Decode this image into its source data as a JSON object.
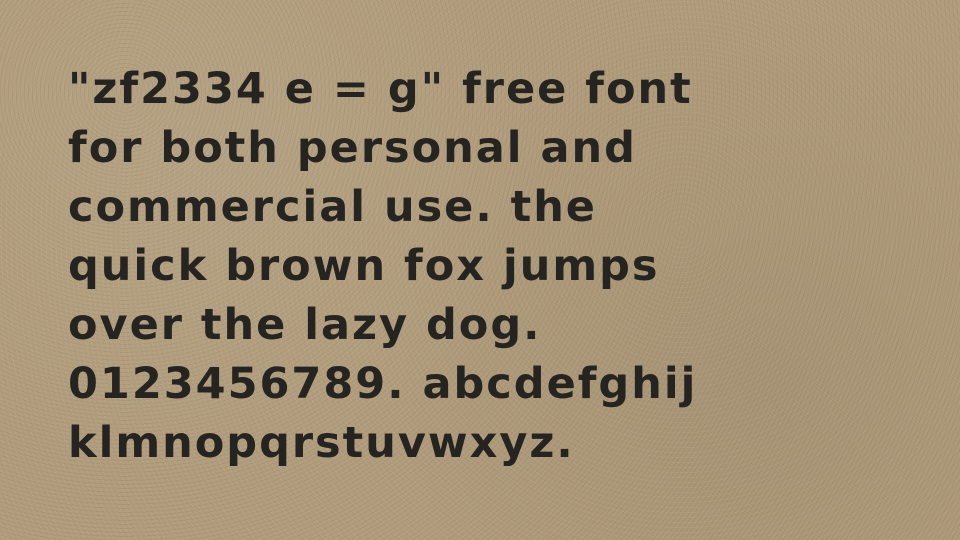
{
  "sample": {
    "lines": [
      "\"ZF2334 E = G\" FREE FONT",
      "FOR BOTH PERSONAL AND",
      "COMMERCIAL USE. THE",
      "QUICK BROWN FOX JUMPS",
      "OVER THE LAZY DOG.",
      "0123456789. ABCDEFGHIJ",
      "KLMNOPQRSTUVWXYZ."
    ]
  },
  "colors": {
    "background": "#b29e7e",
    "text": "#262421"
  }
}
